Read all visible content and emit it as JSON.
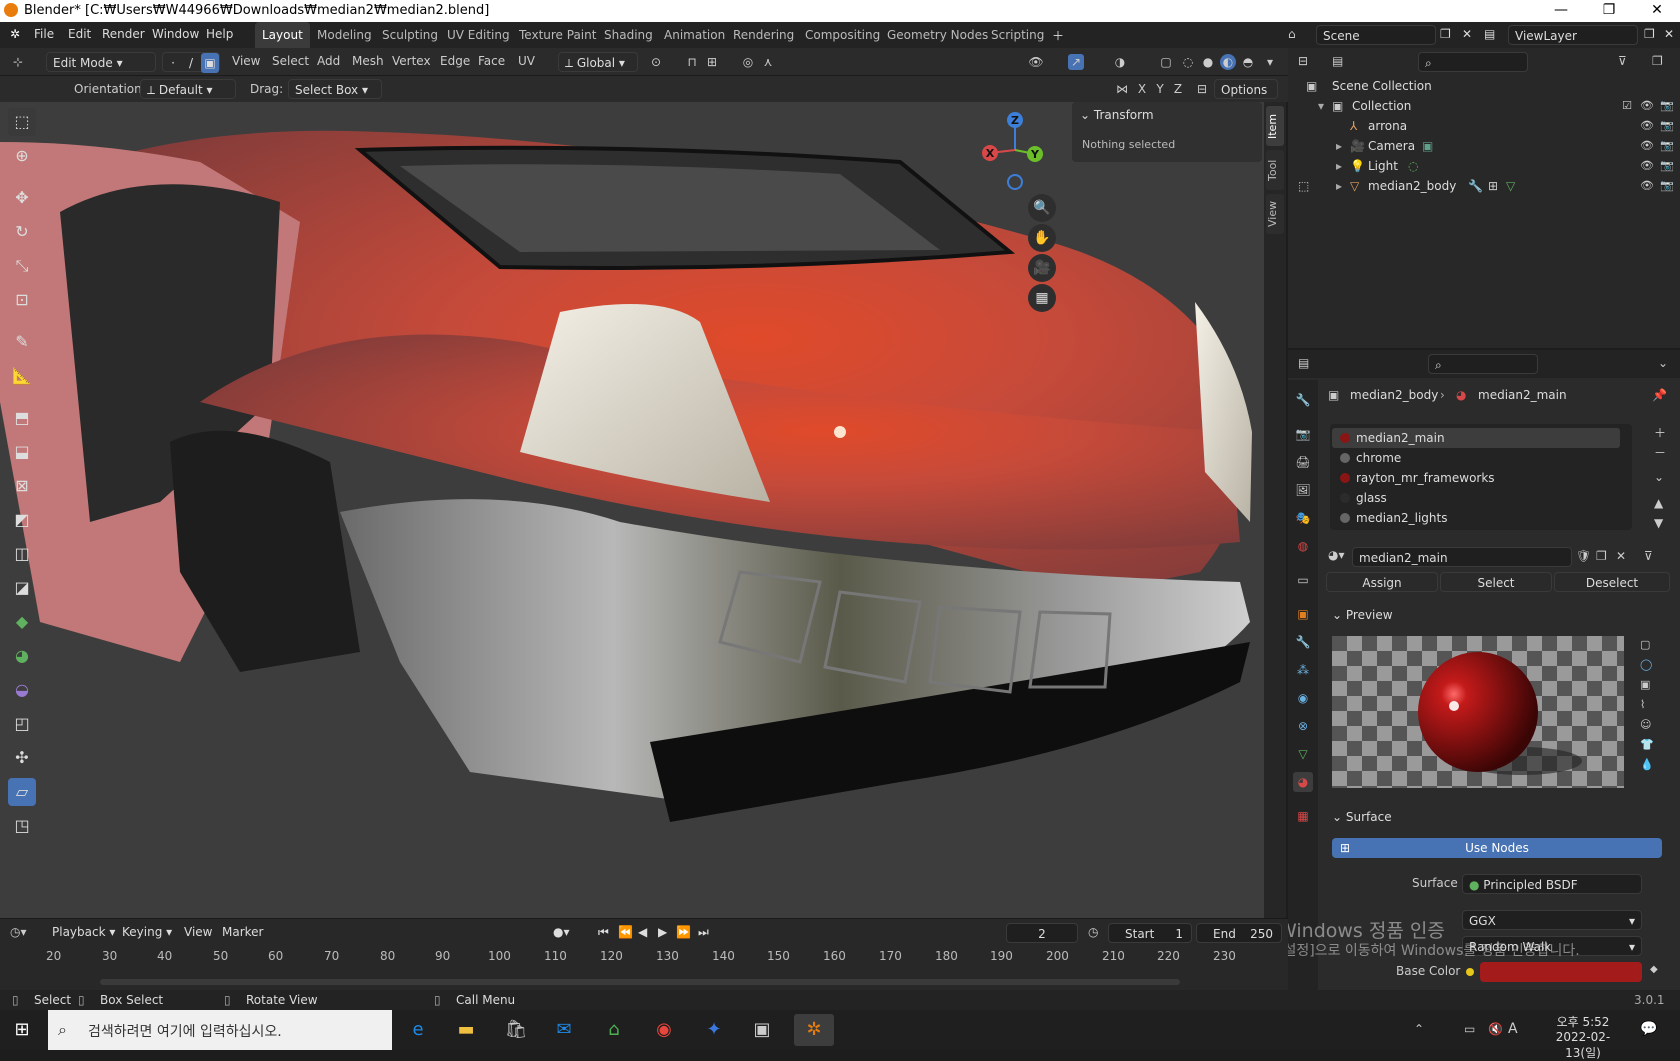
{
  "window": {
    "title": "Blender* [C:₩Users₩W44966₩Downloads₩median2₩median2.blend]"
  },
  "menu": [
    "File",
    "Edit",
    "Render",
    "Window",
    "Help"
  ],
  "workspaces": [
    "Layout",
    "Modeling",
    "Sculpting",
    "UV Editing",
    "Texture Paint",
    "Shading",
    "Animation",
    "Rendering",
    "Compositing",
    "Geometry Nodes",
    "Scripting"
  ],
  "top_right": {
    "scene": "Scene",
    "view_layer": "ViewLayer"
  },
  "viewport_header": {
    "mode": "Edit Mode",
    "menus": [
      "View",
      "Select",
      "Add",
      "Mesh",
      "Vertex",
      "Edge",
      "Face",
      "UV"
    ],
    "transform_orientation": "Global",
    "orientation_label": "Orientation:",
    "orientation_value": "Default",
    "drag_label": "Drag:",
    "drag_value": "Select Box",
    "options": "Options",
    "axes": [
      "X",
      "Y",
      "Z"
    ]
  },
  "npanel": {
    "header": "Transform",
    "content": "Nothing selected",
    "tabs": [
      "Item",
      "Tool",
      "View"
    ]
  },
  "gizmo": {
    "x": "X",
    "y": "Y",
    "z": "Z"
  },
  "outliner": {
    "root": "Scene Collection",
    "collection": "Collection",
    "items": [
      "arrona",
      "Camera",
      "Light",
      "median2_body"
    ]
  },
  "properties": {
    "breadcrumb_object": "median2_body",
    "breadcrumb_material": "median2_main",
    "slots": [
      "median2_main",
      "chrome",
      "rayton_mr_frameworks",
      "glass",
      "median2_lights"
    ],
    "slot_colors": [
      "#8a1515",
      "#666666",
      "#8a1515",
      "#2b2b2b",
      "#666666"
    ],
    "material_name": "median2_main",
    "assign": "Assign",
    "select": "Select",
    "deselect": "Deselect",
    "preview": "Preview",
    "surface_header": "Surface",
    "use_nodes": "Use Nodes",
    "surface_label": "Surface",
    "surface_value": "Principled BSDF",
    "distribution": "GGX",
    "subsurface": "Random Walk",
    "base_color_label": "Base Color",
    "base_color": "#a31b1b"
  },
  "timeline": {
    "menus": [
      "Playback",
      "Keying",
      "View",
      "Marker"
    ],
    "current_frame": "2",
    "start_label": "Start",
    "start": "1",
    "end_label": "End",
    "end": "250",
    "ticks": [
      "20",
      "30",
      "40",
      "50",
      "60",
      "70",
      "80",
      "90",
      "100",
      "110",
      "120",
      "130",
      "140",
      "150",
      "160",
      "170",
      "180",
      "190",
      "200",
      "210",
      "220",
      "230"
    ]
  },
  "statusbar": {
    "select": "Select",
    "box_select": "Box Select",
    "rotate": "Rotate View",
    "call_menu": "Call Menu",
    "version": "3.0.1"
  },
  "watermark": {
    "line1": "Windows 정품 인증",
    "line2": "[설정]으로 이동하여 Windows를 정품 인증합니다."
  },
  "taskbar": {
    "search_placeholder": "검색하려면 여기에 입력하십시오.",
    "time": "오후 5:52",
    "date": "2022-02-13(일)",
    "ime": "A"
  }
}
